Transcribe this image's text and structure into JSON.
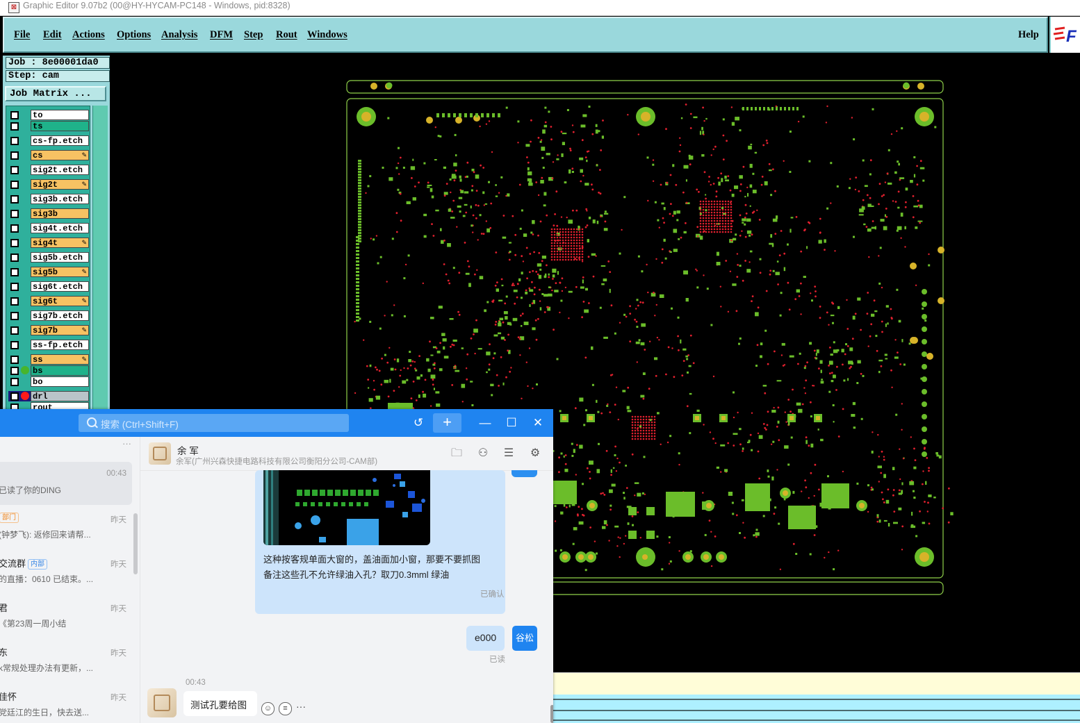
{
  "window": {
    "title": "Graphic Editor 9.07b2 (00@HY-HYCAM-PC148 - Windows, pid:8328)"
  },
  "menubar": {
    "items": [
      "File",
      "Edit",
      "Actions",
      "Options",
      "Analysis",
      "DFM",
      "Step",
      "Rout",
      "Windows"
    ],
    "help": "Help",
    "brand": "F"
  },
  "job": {
    "job_line": "Job : 8e00001da0",
    "step_line": "Step: cam",
    "matrix_button": "Job Matrix ..."
  },
  "layers": [
    {
      "name": "to",
      "color": "#ffffff",
      "dot": "",
      "pen": false,
      "selected": false
    },
    {
      "name": "ts",
      "color": "#1fb28a",
      "dot": "",
      "pen": false,
      "selected": false
    },
    {
      "name": "cs-fp.etch",
      "color": "#ffffff",
      "dot": "",
      "pen": false,
      "selected": false
    },
    {
      "name": "cs",
      "color": "#f7c263",
      "dot": "",
      "pen": true,
      "selected": false
    },
    {
      "name": "sig2t.etch",
      "color": "#ffffff",
      "dot": "",
      "pen": false,
      "selected": false
    },
    {
      "name": "sig2t",
      "color": "#f7c263",
      "dot": "",
      "pen": true,
      "selected": false
    },
    {
      "name": "sig3b.etch",
      "color": "#ffffff",
      "dot": "",
      "pen": false,
      "selected": false
    },
    {
      "name": "sig3b",
      "color": "#f7c263",
      "dot": "",
      "pen": false,
      "selected": false
    },
    {
      "name": "sig4t.etch",
      "color": "#ffffff",
      "dot": "",
      "pen": false,
      "selected": false
    },
    {
      "name": "sig4t",
      "color": "#f7c263",
      "dot": "",
      "pen": true,
      "selected": false
    },
    {
      "name": "sig5b.etch",
      "color": "#ffffff",
      "dot": "",
      "pen": false,
      "selected": false
    },
    {
      "name": "sig5b",
      "color": "#f7c263",
      "dot": "",
      "pen": true,
      "selected": false
    },
    {
      "name": "sig6t.etch",
      "color": "#ffffff",
      "dot": "",
      "pen": false,
      "selected": false
    },
    {
      "name": "sig6t",
      "color": "#f7c263",
      "dot": "",
      "pen": true,
      "selected": false
    },
    {
      "name": "sig7b.etch",
      "color": "#ffffff",
      "dot": "",
      "pen": false,
      "selected": false
    },
    {
      "name": "sig7b",
      "color": "#f7c263",
      "dot": "",
      "pen": true,
      "selected": false
    },
    {
      "name": "ss-fp.etch",
      "color": "#ffffff",
      "dot": "",
      "pen": false,
      "selected": false
    },
    {
      "name": "ss",
      "color": "#f7c263",
      "dot": "",
      "pen": true,
      "selected": false
    },
    {
      "name": "bs",
      "color": "#1fb28a",
      "dot": "#47b52d",
      "pen": false,
      "selected": false
    },
    {
      "name": "bo",
      "color": "#ffffff",
      "dot": "",
      "pen": false,
      "selected": false
    },
    {
      "name": "drl",
      "color": "#b9c4c9",
      "dot": "#ff1a1a",
      "pen": false,
      "selected": true
    },
    {
      "name": "rout",
      "color": "#ffffff",
      "dot": "",
      "pen": false,
      "selected": false
    }
  ],
  "board_colors": {
    "green": "#6bbd2a",
    "red": "#e0202e",
    "yellow": "#d7b329",
    "outline": "#8fd14a"
  },
  "chat": {
    "search_placeholder": "搜索 (Ctrl+Shift+F)",
    "list_more": "···",
    "conversations": [
      {
        "name": "",
        "msg": "已读了你的DING",
        "time": "00:43",
        "tag": "",
        "tagclass": ""
      },
      {
        "name": "",
        "msg": "(钟梦飞): 返修回来请帮...",
        "time": "昨天",
        "tag": "部门",
        "tagclass": "org"
      },
      {
        "name": "交流群",
        "msg": "的直播：0610 已结束。...",
        "time": "昨天",
        "tag": "内部",
        "tagclass": ""
      },
      {
        "name": "君",
        "msg": "《第23周一周小结",
        "time": "昨天",
        "tag": "",
        "tagclass": ""
      },
      {
        "name": "东",
        "msg": "k常规处理办法有更新，...",
        "time": "昨天",
        "tag": "",
        "tagclass": ""
      },
      {
        "name": "佳怀",
        "msg": "党廷江的生日，快去送...",
        "time": "昨天",
        "tag": "",
        "tagclass": ""
      }
    ],
    "contact": {
      "name": "余 军",
      "subtitle": "余军(广州兴森快捷电路科技有限公司衡阳分公司-CAM部)"
    },
    "messages": {
      "image_caption_line1": "这种按客规单面大窗的，盖油面加小窗，那要不要抓图",
      "image_caption_line2": "备注这些孔不允许绿油入孔？取刀0.3mml 绿油",
      "image_status": "已确认",
      "my_msg": "e000",
      "my_status": "已读",
      "my_avatar": "谷松",
      "incoming_time": "00:43",
      "incoming_msg": "测试孔要给图"
    }
  }
}
